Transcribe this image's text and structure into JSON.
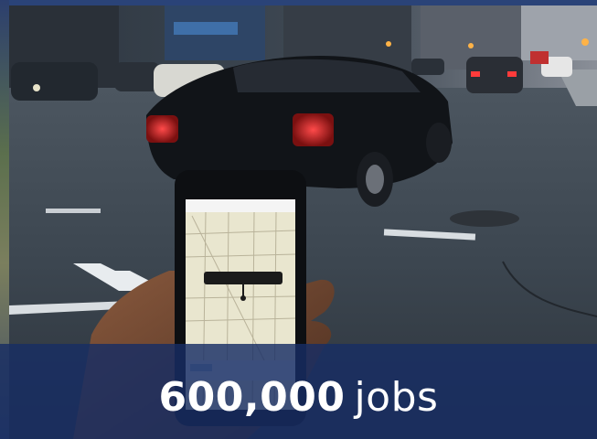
{
  "caption": {
    "number": "600,000",
    "unit": "jobs"
  },
  "photo": {
    "subject": "street-scene-with-ride-hailing-app-phone"
  },
  "colors": {
    "caption_band": "#172d64",
    "caption_text": "#ffffff"
  }
}
